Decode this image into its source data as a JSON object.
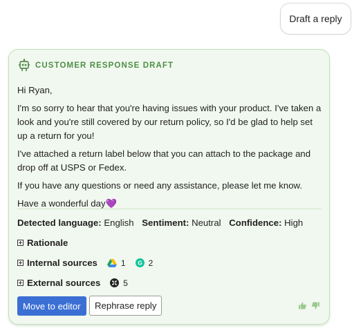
{
  "draft_button_label": "Draft a reply",
  "card": {
    "title": "CUSTOMER RESPONSE DRAFT",
    "greeting": "Hi Ryan,",
    "paragraph1": "I'm so sorry to hear that you're having issues with your product. I've taken a look and you're still covered by our return policy, so I'd be glad to help set up a return for you!",
    "paragraph2": "I've attached a return label below that you can attach to the package and drop off at USPS or Fedex.",
    "paragraph3": "If you have any questions or need any assistance, please let me know.",
    "closing": "Have a wonderful day",
    "closing_emoji": "💜"
  },
  "meta": {
    "language_label": "Detected language:",
    "language_value": "English",
    "sentiment_label": "Sentiment:",
    "sentiment_value": "Neutral",
    "confidence_label": "Confidence:",
    "confidence_value": "High"
  },
  "sections": {
    "rationale": "Rationale",
    "internal_sources": "Internal sources",
    "external_sources": "External sources",
    "drive_count": "1",
    "grammarly_count": "2",
    "external_count": "5"
  },
  "actions": {
    "move_to_editor": "Move to editor",
    "rephrase": "Rephrase reply"
  },
  "colors": {
    "card_bg": "#f1f8ef",
    "card_border": "#bfe1b5",
    "title_green": "#4d8f45",
    "primary_blue": "#3b6fd4"
  },
  "icons": [
    "robot-icon",
    "plus-box-icon",
    "google-drive-icon",
    "grammarly-icon",
    "external-source-icon",
    "thumbs-up-icon",
    "thumbs-down-icon"
  ]
}
